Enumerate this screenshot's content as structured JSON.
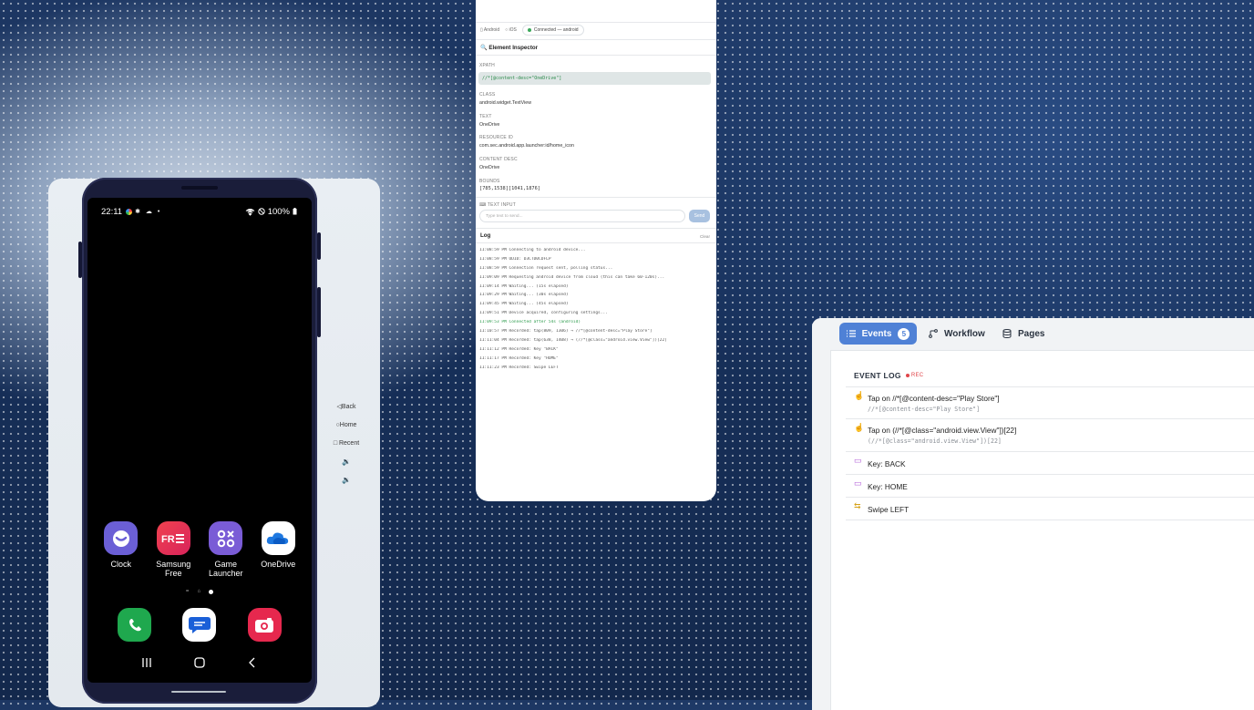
{
  "phone": {
    "time": "22:11",
    "status_icons": "✱ ☁ •",
    "battery": "100%",
    "apps": [
      {
        "label": "Clock",
        "color": "#6b5fd6",
        "icon": "clock-icon"
      },
      {
        "label": "Samsung Free",
        "color": "#e83a55",
        "icon": "samsung-free-icon"
      },
      {
        "label": "Game Launcher",
        "color": "#7a5cd6",
        "icon": "game-launcher-icon"
      },
      {
        "label": "OneDrive",
        "color": "#ffffff",
        "icon": "onedrive-icon"
      }
    ],
    "dock": [
      {
        "icon": "phone-icon",
        "color": "#1fa84e"
      },
      {
        "icon": "messages-icon",
        "color": "#ffffff"
      },
      {
        "icon": "camera-icon",
        "color": "#e6284e"
      }
    ],
    "pager_glyphs": [
      "=",
      "⌂"
    ],
    "controls": {
      "back": "◁Back",
      "home": "○Home",
      "recent": "□ Recent",
      "vol_up": "🔉",
      "vol_down": "🔉"
    }
  },
  "inspector": {
    "platforms": {
      "android": "Android",
      "ios": "iOS"
    },
    "connection": "Connected — android",
    "heading": "🔍 Element Inspector",
    "fields": {
      "xpath_label": "XPATH",
      "xpath": "//*[@content-desc=\"OneDrive\"]",
      "class_label": "CLASS",
      "class": "android.widget.TextView",
      "text_label": "TEXT",
      "text": "OneDrive",
      "resource_label": "RESOURCE ID",
      "resource": "com.sec.android.app.launcher:id/home_icon",
      "content_label": "CONTENT DESC",
      "content": "OneDrive",
      "bounds_label": "BOUNDS",
      "bounds": "[785,1538][1041,1876]"
    },
    "text_input_label": "⌨ TEXT INPUT",
    "text_input_placeholder": "Type text to send...",
    "send_label": "Send",
    "log_title": "Log",
    "clear_label": "Clear",
    "log": [
      {
        "t": "11:08:59 PM Connecting to android device...",
        "ok": false
      },
      {
        "t": "11:08:59 PM UDID: D3CTD0CDFLP",
        "ok": false
      },
      {
        "t": "11:08:59 PM Connection request sent, polling status...",
        "ok": false
      },
      {
        "t": "11:09:09 PM Requesting android device from cloud (this can take 60-120s)...",
        "ok": false
      },
      {
        "t": "11:09:14 PM Waiting... (15s elapsed)",
        "ok": false
      },
      {
        "t": "11:09:29 PM Waiting... (30s elapsed)",
        "ok": false
      },
      {
        "t": "11:09:45 PM Waiting... (45s elapsed)",
        "ok": false
      },
      {
        "t": "11:09:51 PM Device acquired, configuring settings...",
        "ok": false
      },
      {
        "t": "11:09:53 PM Connected after 54s (android)",
        "ok": true
      },
      {
        "t": "11:10:57 PM Recorded: tap(809, 1306) → //*[@content-desc=\"Play Store\"]",
        "ok": false
      },
      {
        "t": "11:11:04 PM Recorded: tap(638, 1408) → (//*[@class=\"android.view.View\"])[22]",
        "ok": false
      },
      {
        "t": "11:11:12 PM Recorded: Key \"BACK\"",
        "ok": false
      },
      {
        "t": "11:11:17 PM Recorded: Key \"HOME\"",
        "ok": false
      },
      {
        "t": "11:11:23 PM Recorded: Swipe LEFT",
        "ok": false
      }
    ]
  },
  "events": {
    "tabs": {
      "events": "Events",
      "count": "5",
      "workflow": "Workflow",
      "pages": "Pages"
    },
    "title": "EVENT LOG",
    "rec": "REC",
    "items": [
      {
        "icon": "tap-icon",
        "glyph": "☝",
        "color": "#e08a3a",
        "main": "Tap on //*[@content-desc=\"Play Store\"]",
        "sub": "//*[@content-desc=\"Play Store\"]"
      },
      {
        "icon": "tap-icon",
        "glyph": "☝",
        "color": "#e08a3a",
        "main": "Tap on (//*[@class=\"android.view.View\"])[22]",
        "sub": "(//*[@class=\"android.view.View\"])[22]"
      },
      {
        "icon": "key-icon",
        "glyph": "▭",
        "color": "#b05ad6",
        "main": "Key: BACK",
        "sub": ""
      },
      {
        "icon": "key-icon",
        "glyph": "▭",
        "color": "#b05ad6",
        "main": "Key: HOME",
        "sub": ""
      },
      {
        "icon": "swipe-icon",
        "glyph": "⇆",
        "color": "#d6a21a",
        "main": "Swipe LEFT",
        "sub": ""
      }
    ]
  }
}
